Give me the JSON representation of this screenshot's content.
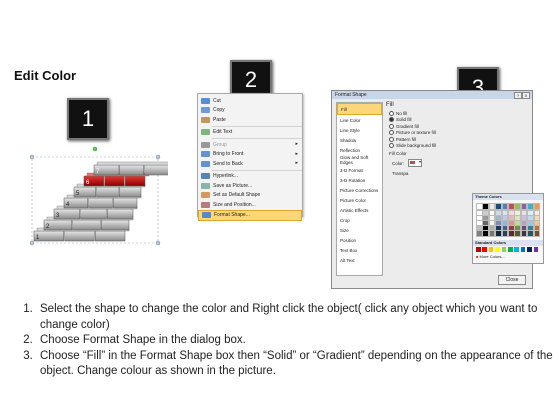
{
  "title": "Edit Color",
  "step_numbers": [
    "1",
    "2",
    "3"
  ],
  "stairs_labels": [
    "1",
    "2",
    "3",
    "4",
    "5",
    "6",
    "7"
  ],
  "context_menu": {
    "items": [
      {
        "label": "Cut",
        "icon": "scissors-icon",
        "arrow": false
      },
      {
        "label": "Copy",
        "icon": "copy-icon",
        "arrow": false
      },
      {
        "label": "Paste",
        "icon": "paste-icon",
        "arrow": false
      },
      {
        "label": "Edit Text",
        "icon": "edit-text-icon",
        "arrow": false,
        "sep_before": true
      },
      {
        "label": "Group",
        "icon": "group-icon",
        "arrow": true,
        "sep_before": true
      },
      {
        "label": "Bring to Front",
        "icon": "bring-front-icon",
        "arrow": true
      },
      {
        "label": "Send to Back",
        "icon": "send-back-icon",
        "arrow": true
      },
      {
        "label": "Hyperlink...",
        "icon": "hyperlink-icon",
        "arrow": false,
        "sep_before": true
      },
      {
        "label": "Save as Picture...",
        "icon": "save-picture-icon",
        "arrow": false
      },
      {
        "label": "Set as Default Shape",
        "icon": "default-shape-icon",
        "arrow": false
      },
      {
        "label": "Size and Position...",
        "icon": "size-position-icon",
        "arrow": false
      },
      {
        "label": "Format Shape...",
        "icon": "format-shape-icon",
        "arrow": false,
        "highlight": true
      }
    ]
  },
  "dialog": {
    "title": "Format Shape",
    "help": "?",
    "close_x": "X",
    "categories": [
      "Fill",
      "Line Color",
      "Line Style",
      "Shadow",
      "Reflection",
      "Glow and Soft Edges",
      "3-D Format",
      "3-D Rotation",
      "Picture Corrections",
      "Picture Color",
      "Artistic Effects",
      "Crop",
      "Size",
      "Position",
      "Text Box",
      "Alt Text"
    ],
    "selected_category": "Fill",
    "fill_heading": "Fill",
    "fill_options": [
      {
        "label": "No fill",
        "checked": false
      },
      {
        "label": "Solid fill",
        "checked": true
      },
      {
        "label": "Gradient fill",
        "checked": false
      },
      {
        "label": "Picture or texture fill",
        "checked": false
      },
      {
        "label": "Pattern fill",
        "checked": false
      },
      {
        "label": "Slide background fill",
        "checked": false
      }
    ],
    "fill_color_heading": "Fill Color",
    "color_label": "Color:",
    "transparency_label": "Transpa",
    "palette": {
      "theme_heading": "Theme Colors",
      "standard_heading": "Standard Colors",
      "more_colors": "More Colors...",
      "theme_top": [
        "#ffffff",
        "#000000",
        "#eeece1",
        "#1f497d",
        "#4f81bd",
        "#c0504d",
        "#9bbb59",
        "#8064a2",
        "#4bacc6",
        "#f79646"
      ],
      "standard": [
        "#c00000",
        "#ff0000",
        "#ffc000",
        "#ffff00",
        "#92d050",
        "#00b050",
        "#00b0f0",
        "#0070c0",
        "#002060",
        "#7030a0"
      ]
    },
    "close_label": "Close"
  },
  "instructions": [
    "Select the shape to change the color and Right click the object( click any object which you want to change color)",
    "Choose Format Shape in the dialog box.",
    "Choose “Fill” in the Format Shape box then “Solid” or “Gradient” depending on the appearance of the object. Change colour as shown in the picture."
  ]
}
